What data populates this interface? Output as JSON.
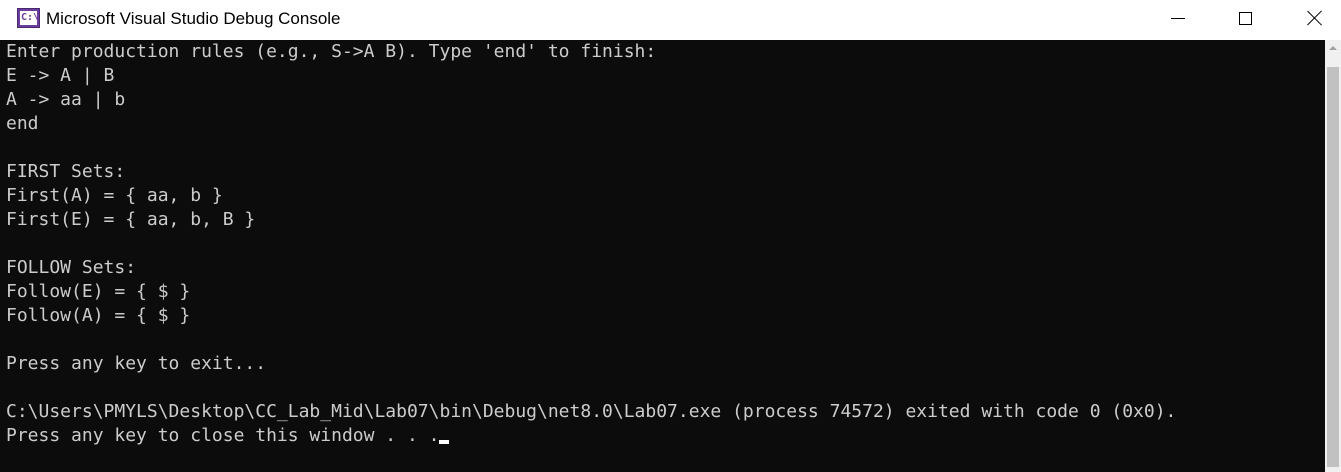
{
  "window": {
    "title": "Microsoft Visual Studio Debug Console",
    "icon": "visual-studio-console-icon",
    "icon_glyph": "C:\\",
    "controls": {
      "minimize": "minimize-icon",
      "maximize": "maximize-icon",
      "close": "close-icon"
    }
  },
  "console": {
    "lines": [
      "Enter production rules (e.g., S->A B). Type 'end' to finish:",
      "E -> A | B",
      "A -> aa | b",
      "end",
      "",
      "FIRST Sets:",
      "First(A) = { aa, b }",
      "First(E) = { aa, b, B }",
      "",
      "FOLLOW Sets:",
      "Follow(E) = { $ }",
      "Follow(A) = { $ }",
      "",
      "Press any key to exit...",
      "",
      "C:\\Users\\PMYLS\\Desktop\\CC_Lab_Mid\\Lab07\\bin\\Debug\\net8.0\\Lab07.exe (process 74572) exited with code 0 (0x0).",
      "Press any key to close this window . . ."
    ],
    "colors": {
      "background": "#0c0c0c",
      "text": "#cccccc",
      "cursor": "#ffffff"
    }
  },
  "scrollbar": {
    "up_arrow": "scroll-up-arrow-icon"
  }
}
